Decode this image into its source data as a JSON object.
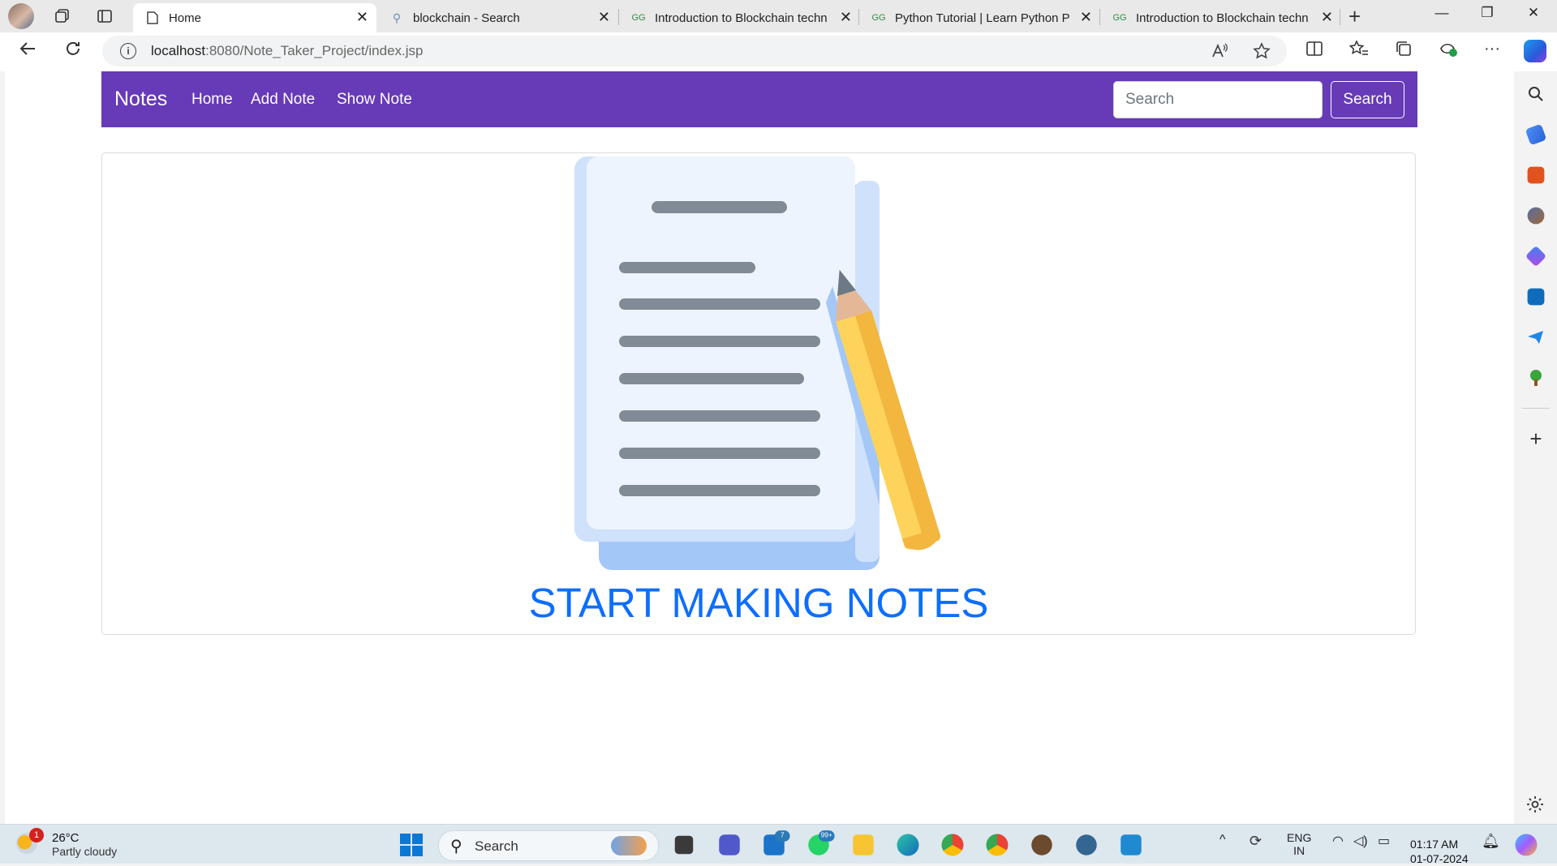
{
  "browser": {
    "tabs": [
      {
        "title": "Home",
        "active": true,
        "icon": "page-icon"
      },
      {
        "title": "blockchain - Search",
        "active": false,
        "icon": "search-icon"
      },
      {
        "title": "Introduction to Blockchain techn",
        "active": false,
        "icon": "gfg-icon"
      },
      {
        "title": "Python Tutorial | Learn Python P",
        "active": false,
        "icon": "gfg-icon"
      },
      {
        "title": "Introduction to Blockchain techn",
        "active": false,
        "icon": "gfg-icon"
      }
    ],
    "address": {
      "host": "localhost",
      "rest": ":8080/Note_Taker_Project/index.jsp"
    }
  },
  "page": {
    "brand": "Notes",
    "nav": {
      "home": "Home",
      "add": "Add Note",
      "show": "Show Note"
    },
    "search": {
      "placeholder": "Search",
      "button": "Search"
    },
    "headline": "START MAKING NOTES",
    "colors": {
      "navbar": "#673ab7",
      "headline": "#0d6efd"
    }
  },
  "taskbar": {
    "weather": {
      "temp": "26°C",
      "desc": "Partly cloudy",
      "badge": "1"
    },
    "search": "Search",
    "badges": {
      "mail": "7",
      "whatsapp": "99+"
    },
    "lang": {
      "line1": "ENG",
      "line2": "IN"
    },
    "clock": {
      "time": "01:17 AM",
      "date": "01-07-2024"
    }
  }
}
